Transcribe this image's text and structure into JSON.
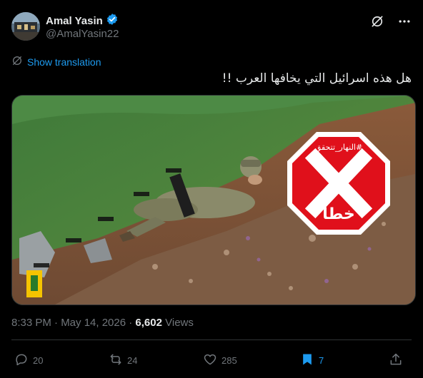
{
  "user": {
    "name": "Amal Yasin",
    "handle": "@AmalYasin22"
  },
  "tweet": {
    "show_translation": "Show translation",
    "text": "هل هذه اسرائيل التي يخافها العرب !!"
  },
  "media": {
    "stamp_top": "#النهار_تتحقق",
    "stamp_bottom": "خطأ"
  },
  "meta": {
    "time": "8:33 PM · May 14, 2026 · ",
    "views_count": "6,602",
    "views_label": " Views"
  },
  "actions": {
    "replies": "20",
    "reposts": "24",
    "likes": "285",
    "bookmarks": "7"
  },
  "colors": {
    "accent": "#1d9bf0",
    "stamp_red": "#e0101b",
    "background": "#000000"
  },
  "icons": [
    "verified-badge-icon",
    "grok-icon",
    "more-icon",
    "translate-icon",
    "reply-icon",
    "repost-icon",
    "like-icon",
    "bookmark-icon",
    "share-icon"
  ]
}
